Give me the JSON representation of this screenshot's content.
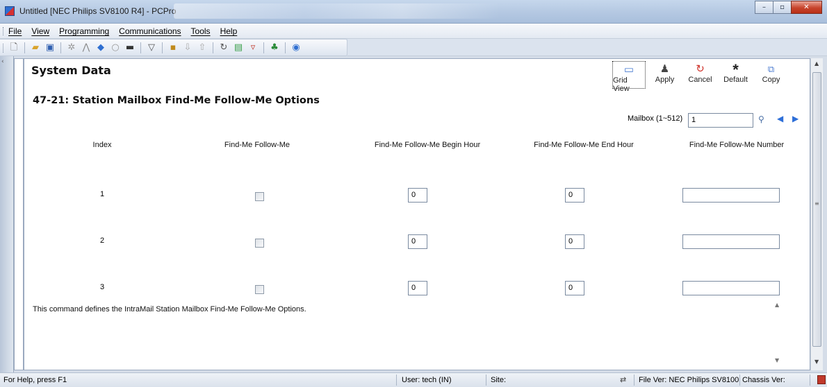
{
  "window": {
    "title": "Untitled [NEC Philips SV8100 R4] - PCPro",
    "controls": {
      "minimize": "–",
      "maximize": "▫",
      "close": "✕"
    }
  },
  "menu": {
    "items": [
      "File",
      "View",
      "Programming",
      "Communications",
      "Tools",
      "Help"
    ]
  },
  "toolbar": {
    "icons": [
      "new-icon",
      "open-icon",
      "save-icon",
      "wizard-icon",
      "hierarchy-icon",
      "shield-icon",
      "search-icon",
      "hardware-icon",
      "filter-icon",
      "connect-icon",
      "download-icon",
      "upload-icon",
      "refresh-icon",
      "document-icon",
      "certificate-icon",
      "users-icon",
      "help-icon"
    ]
  },
  "panel": {
    "section_title": "System Data",
    "page_title": "47-21: Station Mailbox Find-Me Follow-Me Options",
    "actions": [
      {
        "label": "Grid View",
        "icon": "grid-view-icon"
      },
      {
        "label": "Apply",
        "icon": "apply-icon"
      },
      {
        "label": "Cancel",
        "icon": "cancel-icon"
      },
      {
        "label": "Default",
        "icon": "default-icon"
      },
      {
        "label": "Copy",
        "icon": "copy-icon"
      }
    ],
    "mailbox": {
      "label": "Mailbox (1~512)",
      "value": "1"
    },
    "columns": [
      "Index",
      "Find-Me Follow-Me",
      "Find-Me Follow-Me Begin Hour",
      "Find-Me Follow-Me End Hour",
      "Find-Me Follow-Me Number"
    ],
    "rows": [
      {
        "index": "1",
        "enabled": false,
        "begin_hour": "0",
        "end_hour": "0",
        "number": ""
      },
      {
        "index": "2",
        "enabled": false,
        "begin_hour": "0",
        "end_hour": "0",
        "number": ""
      },
      {
        "index": "3",
        "enabled": false,
        "begin_hour": "0",
        "end_hour": "0",
        "number": ""
      }
    ],
    "description": "This command defines the IntraMail Station Mailbox Find-Me Follow-Me Options."
  },
  "statusbar": {
    "help": "For Help, press F1",
    "user": "User: tech (IN)",
    "site": "Site:",
    "file_ver": "File Ver: NEC Philips SV8100",
    "chassis_ver": "Chassis Ver:"
  }
}
